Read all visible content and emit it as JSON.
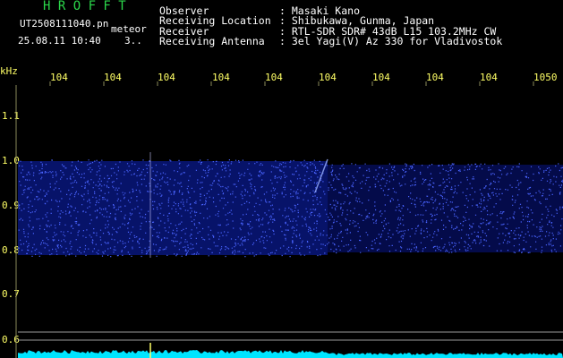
{
  "app": {
    "name": "H R O F F T",
    "filename": "UT2508111040.pn",
    "mode": "meteor",
    "datetime": "25.08.11 10:40",
    "counter": "3.."
  },
  "header": {
    "observer_label": "Observer",
    "observer_value": ": Masaki Kano",
    "location_label": "Receiving Location",
    "location_value": ": Shibukawa, Gunma, Japan",
    "receiver_label": "Receiver",
    "receiver_value": ": RTL-SDR SDR# 43dB L15 103.2MHz CW",
    "antenna_label": "Receiving Antenna",
    "antenna_value": ": 3el Yagi(V) Az 330 for Vladivostok"
  },
  "axis": {
    "unit": "kHz",
    "y_ticks": [
      "1.1",
      "1.0",
      "0.9",
      "0.8",
      "0.7",
      "0.6"
    ],
    "x_ticks": [
      "104",
      "104",
      "104",
      "104",
      "104",
      "104",
      "104",
      "104",
      "104",
      "1050"
    ]
  },
  "colors": {
    "background": "#000000",
    "signal": "#2a3cff",
    "title": "#2bd64a",
    "labels": "#ffff66",
    "baseline": "#00e5ff",
    "grid": "#8a8a5a"
  }
}
